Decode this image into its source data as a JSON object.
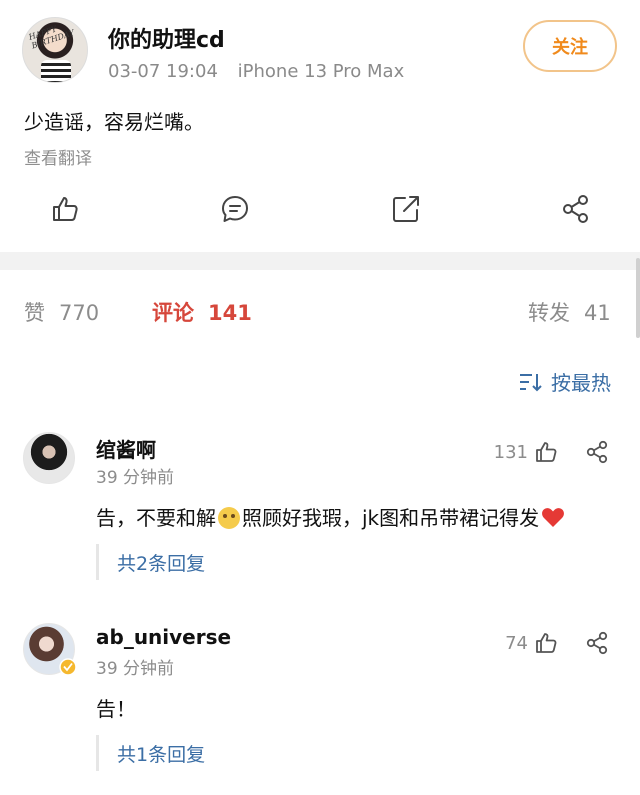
{
  "post": {
    "username": "你的助理cd",
    "date": "03-07 19:04",
    "device": "iPhone 13 Pro Max",
    "follow_label": "关注",
    "content": "少造谣，容易烂嘴。",
    "translate_label": "查看翻译",
    "avatar_text": "HAPPY BIRTHDAY"
  },
  "stats": {
    "likes_label": "赞",
    "likes_count": "770",
    "comments_label": "评论",
    "comments_count": "141",
    "reposts_label": "转发",
    "reposts_count": "41"
  },
  "sort": {
    "label": "按最热"
  },
  "comments": [
    {
      "name": "绾酱啊",
      "time": "39 分钟前",
      "text_before": "告，不要和解",
      "text_after": "照顾好我瑕，jk图和吊带裙记得发",
      "likes": "131",
      "replies_label": "共2条回复"
    },
    {
      "name": "ab_universe",
      "time": "39 分钟前",
      "text_before": "告！",
      "text_after": "",
      "likes": "74",
      "replies_label": "共1条回复"
    }
  ],
  "colors": {
    "accent_blue": "#3b6ea5",
    "accent_red": "#d6473b",
    "follow_orange": "#f08a1c"
  },
  "icons": [
    "thumbs-up-icon",
    "comment-icon",
    "repost-icon",
    "share-icon",
    "sort-icon",
    "heart-icon",
    "emoji-icon",
    "verified-badge-icon"
  ]
}
